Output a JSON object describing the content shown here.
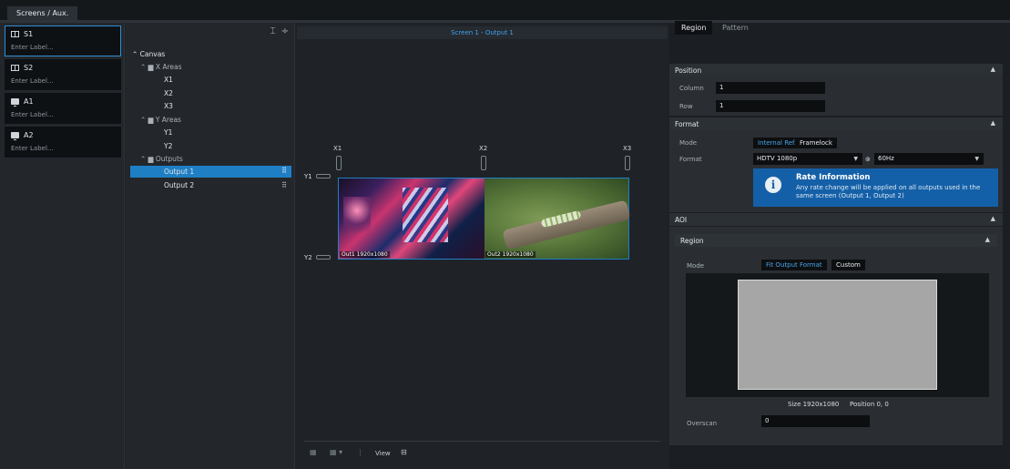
{
  "top_tab": "Screens / Aux.",
  "screens": [
    {
      "name": "S1",
      "type": "screen",
      "placeholder": "Enter Label..."
    },
    {
      "name": "S2",
      "type": "screen",
      "placeholder": "Enter Label..."
    },
    {
      "name": "A1",
      "type": "aux",
      "placeholder": "Enter Label..."
    },
    {
      "name": "A2",
      "type": "aux",
      "placeholder": "Enter Label..."
    }
  ],
  "tree": {
    "root": "Canvas",
    "x_areas": "X Areas",
    "x_items": [
      "X1",
      "X2",
      "X3"
    ],
    "y_areas": "Y Areas",
    "y_items": [
      "Y1",
      "Y2"
    ],
    "outputs": "Outputs",
    "output_items": [
      "Output 1",
      "Output 2"
    ]
  },
  "canvas": {
    "header": "Screen 1 - Output 1",
    "x_labels": [
      "X1",
      "X2",
      "X3"
    ],
    "y_labels": [
      "Y1",
      "Y2"
    ],
    "out1_label": "Out1 1920x1080",
    "out2_label": "Out2 1920x1080",
    "view_label": "View"
  },
  "right": {
    "tabs": [
      "Region",
      "Pattern"
    ],
    "position": {
      "title": "Position",
      "column_label": "Column",
      "column_value": "1",
      "row_label": "Row",
      "row_value": "1"
    },
    "format": {
      "title": "Format",
      "mode_label": "Mode",
      "mode_options": [
        "Internal Ref.",
        "Framelock"
      ],
      "format_label": "Format",
      "format_value": "HDTV 1080p",
      "rate_value": "60Hz",
      "info_title": "Rate Information",
      "info_text": "Any rate change will be applied on all outputs used in the same screen (Output 1, Output 2)"
    },
    "aoi": {
      "title": "AOI",
      "region_title": "Region",
      "mode_label": "Mode",
      "mode_options": [
        "Fit Output Format",
        "Custom"
      ],
      "size_text": "Size 1920x1080",
      "position_text": "Position 0, 0",
      "overscan_label": "Overscan",
      "overscan_value": "0"
    }
  },
  "colors": {
    "accent": "#1f7fc4",
    "info": "#1460a8",
    "link": "#3ea3ea"
  }
}
